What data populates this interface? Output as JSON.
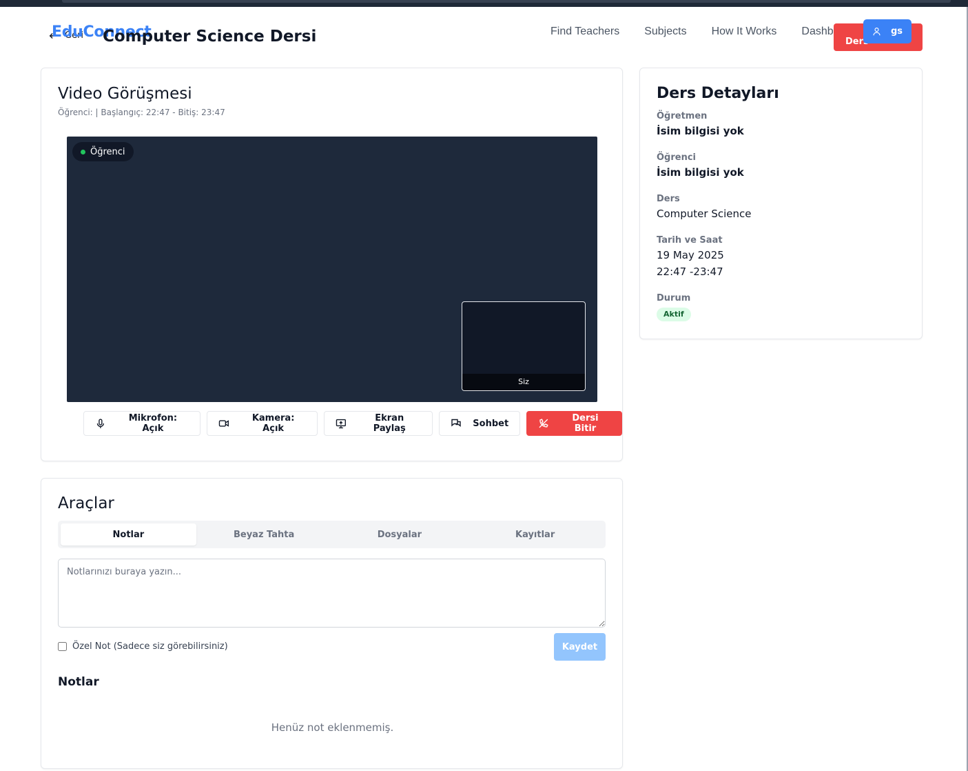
{
  "header": {
    "brand": "EduConnect",
    "back_label": "Geri",
    "page_title": "Computer Science Dersi",
    "nav": [
      "Find Teachers",
      "Subjects",
      "How It Works",
      "Dashboard"
    ],
    "end_lesson_label": "Ders",
    "user_initials": "gs"
  },
  "video": {
    "title": "Video Görüşmesi",
    "subtitle": "Öğrenci: | Başlangıç: 22:47 - Bitiş: 23:47",
    "remote_label": "Öğrenci",
    "self_label": "Siz",
    "controls": {
      "mic": "Mikrofon: Açık",
      "camera": "Kamera: Açık",
      "screen": "Ekran Paylaş",
      "chat": "Sohbet",
      "end": "Dersi Bitir"
    }
  },
  "details": {
    "title": "Ders Detayları",
    "teacher_label": "Öğretmen",
    "teacher_value": "İsim bilgisi yok",
    "student_label": "Öğrenci",
    "student_value": "İsim bilgisi yok",
    "course_label": "Ders",
    "course_value": "Computer Science",
    "datetime_label": "Tarih ve Saat",
    "date_value": "19 May 2025",
    "time_value": "22:47 -23:47",
    "status_label": "Durum",
    "status_value": "Aktif"
  },
  "tools": {
    "title": "Araçlar",
    "tabs": [
      "Notlar",
      "Beyaz Tahta",
      "Dosyalar",
      "Kayıtlar"
    ],
    "notes_placeholder": "Notlarınızı buraya yazın...",
    "private_label": "Özel Not (Sadece siz görebilirsiniz)",
    "save_label": "Kaydet",
    "notes_heading": "Notlar",
    "empty_text": "Henüz not eklenmemiş."
  },
  "colors": {
    "brand": "#3b82f6",
    "danger": "#ef4444",
    "stage": "#1e293b",
    "online": "#22c55e",
    "status_bg": "#dcfce7",
    "save_disabled": "#93c5fd"
  }
}
